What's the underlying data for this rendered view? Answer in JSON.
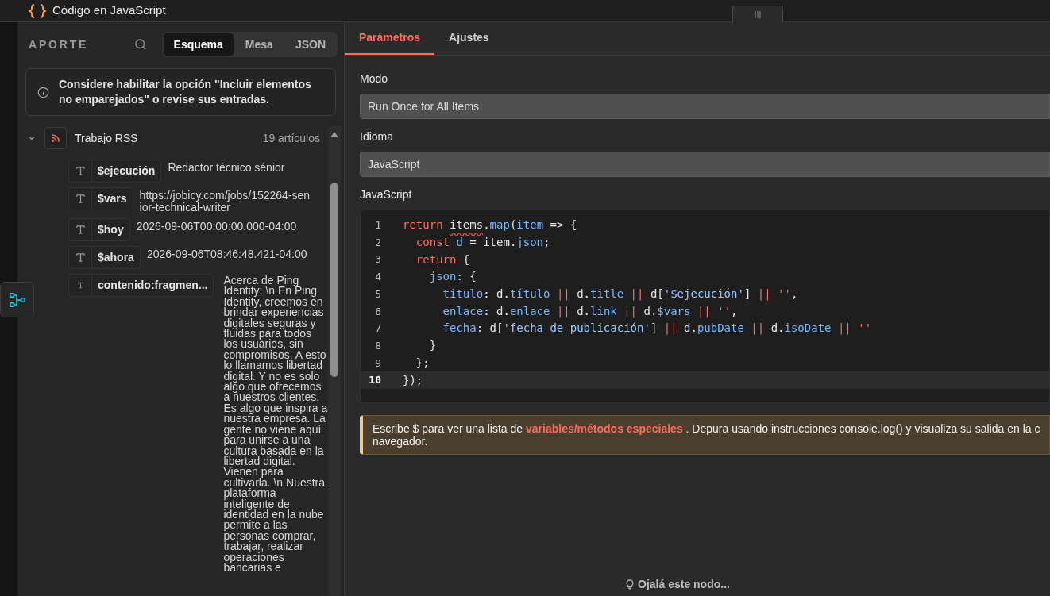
{
  "window": {
    "title": "Código en JavaScript"
  },
  "input_panel": {
    "title": "APORTE",
    "view_tabs": [
      {
        "label": "Esquema",
        "selected": true
      },
      {
        "label": "Mesa",
        "selected": false
      },
      {
        "label": "JSON",
        "selected": false
      }
    ],
    "notice": "Considere habilitar la opción \"Incluir elementos no emparejados\" o revise sus entradas.",
    "tree": {
      "name": "Trabajo RSS",
      "count": "19 artículos",
      "expanded": true,
      "children": [
        {
          "key": "$ejecución",
          "value": "Redactor técnico sénior"
        },
        {
          "key": "$vars",
          "value": "https://jobicy.com/jobs/152264-senior-technical-writer"
        },
        {
          "key": "$hoy",
          "value": "2026-09-06T00:00:00.000-04:00"
        },
        {
          "key": "$ahora",
          "value": "2026-09-06T08:46:48.421-04:00"
        },
        {
          "key": "contenido:fragmen...",
          "kind": "long",
          "value": "Acerca de Ping Identity: \\n En Ping Identity, creemos en brindar experiencias digitales seguras y fluidas para todos los usuarios, sin compromisos. A esto lo llamamos libertad digital. Y no es solo algo que ofrecemos a nuestros clientes. Es algo que inspira a nuestra empresa. La gente no viene aquí para unirse a una cultura basada en la libertad digital. Vienen para cultivarla. \\n Nuestra plataforma inteligente de identidad en la nube permite a las personas comprar, trabajar, realizar operaciones bancarias e"
        }
      ]
    }
  },
  "settings_panel": {
    "tabs": [
      {
        "label": "Parámetros",
        "selected": true
      },
      {
        "label": "Ajustes",
        "selected": false
      }
    ],
    "fields": [
      {
        "label": "Modo",
        "value": "Run Once for All Items"
      },
      {
        "label": "Idioma",
        "value": "JavaScript"
      }
    ],
    "code_label": "JavaScript",
    "code_lines": [
      {
        "number": "1",
        "current": false,
        "tokens": [
          {
            "text": "return ",
            "kind": "keyword"
          },
          {
            "text": "items",
            "kind": "error"
          },
          {
            "text": ".",
            "kind": "plain"
          },
          {
            "text": "map",
            "kind": "property"
          },
          {
            "text": "(",
            "kind": "plain"
          },
          {
            "text": "item",
            "kind": "property"
          },
          {
            "text": " => {",
            "kind": "plain"
          }
        ]
      },
      {
        "number": "2",
        "current": false,
        "tokens": [
          {
            "text": "  const ",
            "kind": "keyword"
          },
          {
            "text": "d",
            "kind": "property"
          },
          {
            "text": " = item.",
            "kind": "plain"
          },
          {
            "text": "json",
            "kind": "property"
          },
          {
            "text": ";",
            "kind": "plain"
          }
        ]
      },
      {
        "number": "3",
        "current": false,
        "tokens": [
          {
            "text": "  return",
            "kind": "keyword"
          },
          {
            "text": " {",
            "kind": "plain"
          }
        ]
      },
      {
        "number": "4",
        "current": false,
        "tokens": [
          {
            "text": "    json",
            "kind": "property"
          },
          {
            "text": ": {",
            "kind": "plain"
          }
        ]
      },
      {
        "number": "5",
        "current": false,
        "tokens": [
          {
            "text": "      titulo",
            "kind": "property"
          },
          {
            "text": ": d.",
            "kind": "plain"
          },
          {
            "text": "título",
            "kind": "property"
          },
          {
            "text": " || ",
            "kind": "keyword"
          },
          {
            "text": "d.",
            "kind": "plain"
          },
          {
            "text": "title",
            "kind": "property"
          },
          {
            "text": " || ",
            "kind": "keyword"
          },
          {
            "text": "d[",
            "kind": "plain"
          },
          {
            "text": "'$ejecución'",
            "kind": "string"
          },
          {
            "text": "] ",
            "kind": "plain"
          },
          {
            "text": "|| ''",
            "kind": "keyword"
          },
          {
            "text": ",",
            "kind": "plain"
          }
        ]
      },
      {
        "number": "6",
        "current": false,
        "tokens": [
          {
            "text": "      enlace",
            "kind": "property"
          },
          {
            "text": ": d.",
            "kind": "plain"
          },
          {
            "text": "enlace",
            "kind": "property"
          },
          {
            "text": " || ",
            "kind": "keyword"
          },
          {
            "text": "d.",
            "kind": "plain"
          },
          {
            "text": "link",
            "kind": "property"
          },
          {
            "text": " || ",
            "kind": "keyword"
          },
          {
            "text": "d.",
            "kind": "plain"
          },
          {
            "text": "$vars",
            "kind": "property"
          },
          {
            "text": " || ''",
            "kind": "keyword"
          },
          {
            "text": ",",
            "kind": "plain"
          }
        ]
      },
      {
        "number": "7",
        "current": false,
        "tokens": [
          {
            "text": "      fecha",
            "kind": "property"
          },
          {
            "text": ": d[",
            "kind": "plain"
          },
          {
            "text": "'fecha de publicación'",
            "kind": "string"
          },
          {
            "text": "] ",
            "kind": "plain"
          },
          {
            "text": "|| ",
            "kind": "keyword"
          },
          {
            "text": "d.",
            "kind": "plain"
          },
          {
            "text": "pubDate",
            "kind": "property"
          },
          {
            "text": " || ",
            "kind": "keyword"
          },
          {
            "text": "d.",
            "kind": "plain"
          },
          {
            "text": "isoDate",
            "kind": "property"
          },
          {
            "text": " || ''",
            "kind": "keyword"
          }
        ]
      },
      {
        "number": "8",
        "current": false,
        "tokens": [
          {
            "text": "    }",
            "kind": "plain"
          }
        ]
      },
      {
        "number": "9",
        "current": false,
        "tokens": [
          {
            "text": "  };",
            "kind": "plain"
          }
        ]
      },
      {
        "number": "10",
        "current": true,
        "tokens": [
          {
            "text": "});",
            "kind": "plain"
          }
        ]
      }
    ],
    "hint": {
      "before": "Escribe $ para ver una lista de ",
      "link": "variables/métodos especiales",
      "after": " . Depura usando instrucciones console.log() y visualiza su salida en la c",
      "second_line": "navegador."
    },
    "footer": "Ojalá este nodo..."
  }
}
